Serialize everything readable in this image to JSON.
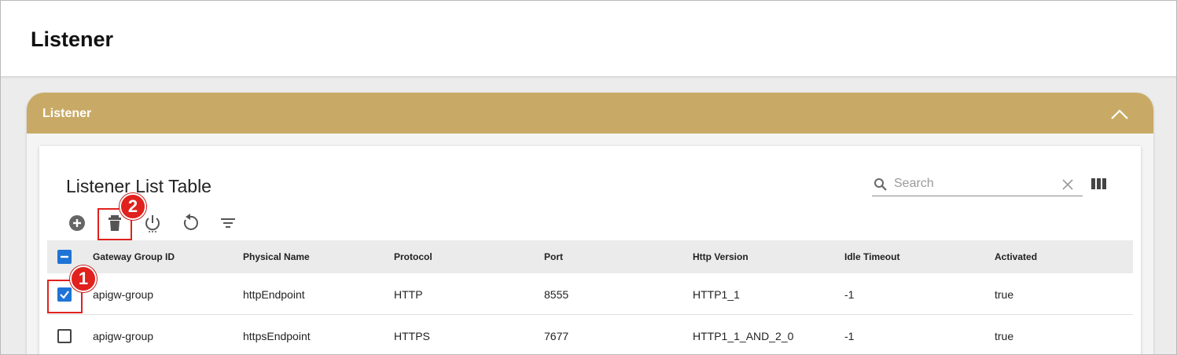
{
  "page": {
    "title": "Listener"
  },
  "panel": {
    "title": "Listener"
  },
  "table": {
    "title": "Listener List Table",
    "search_placeholder": "Search",
    "columns": [
      "Gateway Group ID",
      "Physical Name",
      "Protocol",
      "Port",
      "Http Version",
      "Idle Timeout",
      "Activated"
    ],
    "rows": [
      {
        "selected": true,
        "cells": [
          "apigw-group",
          "httpEndpoint",
          "HTTP",
          "8555",
          "HTTP1_1",
          "-1",
          "true"
        ]
      },
      {
        "selected": false,
        "cells": [
          "apigw-group",
          "httpsEndpoint",
          "HTTPS",
          "7677",
          "HTTP1_1_AND_2_0",
          "-1",
          "true"
        ]
      }
    ]
  },
  "toolbar": {
    "icons": [
      "add-circle-icon",
      "delete-icon",
      "power-icon",
      "refresh-icon",
      "filter-icon"
    ]
  },
  "callouts": {
    "one": "1",
    "two": "2"
  },
  "colors": {
    "panel_header": "#c8aa66",
    "checkbox_blue": "#1f73d6",
    "callout_red": "#e0211d"
  }
}
